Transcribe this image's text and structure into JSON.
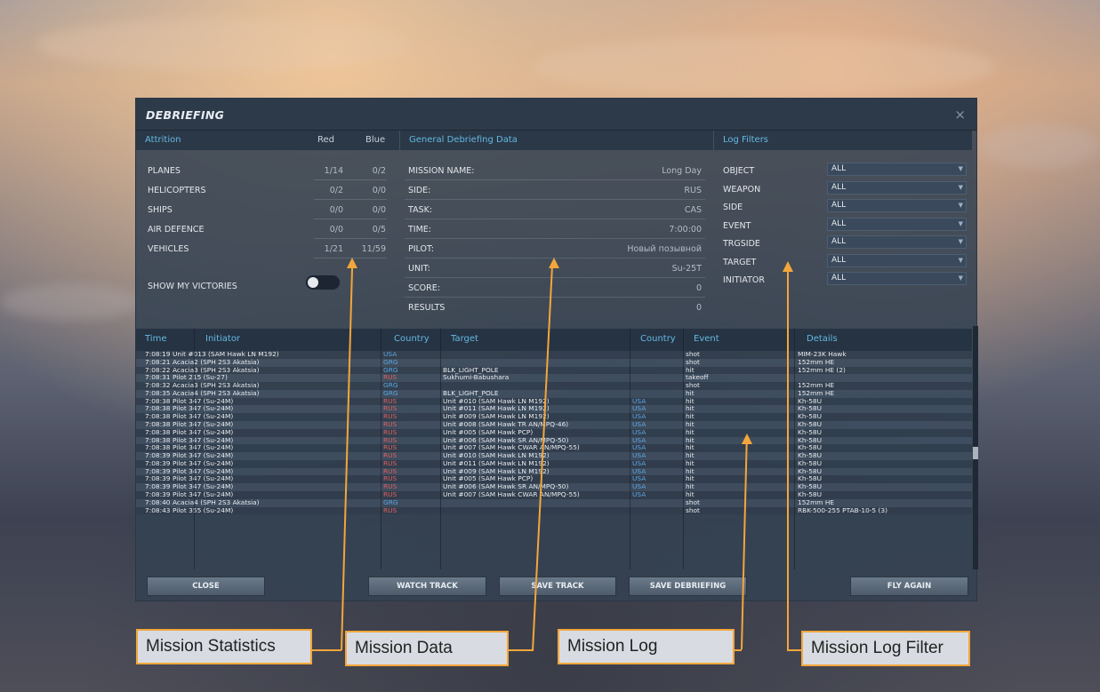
{
  "dialog": {
    "title": "DEBRIEFING",
    "close": "×"
  },
  "sections": {
    "attrition": "Attrition",
    "red": "Red",
    "blue": "Blue",
    "general": "General Debriefing Data",
    "filters": "Log Filters"
  },
  "attrition": [
    {
      "label": "PLANES",
      "red": "1/14",
      "blue": "0/2"
    },
    {
      "label": "HELICOPTERS",
      "red": "0/2",
      "blue": "0/0"
    },
    {
      "label": "SHIPS",
      "red": "0/0",
      "blue": "0/0"
    },
    {
      "label": "AIR DEFENCE",
      "red": "0/0",
      "blue": "0/5"
    },
    {
      "label": "VEHICLES",
      "red": "1/21",
      "blue": "11/59"
    }
  ],
  "show_victories": "SHOW MY VICTORIES",
  "general": [
    {
      "label": "MISSION NAME:",
      "value": "Long Day"
    },
    {
      "label": "SIDE:",
      "value": "RUS"
    },
    {
      "label": "TASK:",
      "value": "CAS"
    },
    {
      "label": "TIME:",
      "value": "7:00:00"
    },
    {
      "label": "PILOT:",
      "value": "Новый позывной"
    },
    {
      "label": "UNIT:",
      "value": "Su-25T"
    },
    {
      "label": "SCORE:",
      "value": "0"
    },
    {
      "label": "RESULTS",
      "value": "0"
    }
  ],
  "filters": [
    {
      "label": "OBJECT",
      "value": "ALL"
    },
    {
      "label": "WEAPON",
      "value": "ALL"
    },
    {
      "label": "SIDE",
      "value": "ALL"
    },
    {
      "label": "EVENT",
      "value": "ALL"
    },
    {
      "label": "TRGSIDE",
      "value": "ALL"
    },
    {
      "label": "TARGET",
      "value": "ALL"
    },
    {
      "label": "INITIATOR",
      "value": "ALL"
    }
  ],
  "log": {
    "headers": [
      "Time",
      "Initiator",
      "Country",
      "Target",
      "Country",
      "Event",
      "Details"
    ],
    "rows": [
      [
        "7:08:19",
        "Unit #013 (SAM Hawk LN M192)",
        "USA",
        "",
        "",
        "shot",
        "MIM-23K Hawk"
      ],
      [
        "7:08:21",
        "Acacia2 (SPH 2S3 Akatsia)",
        "GRG",
        "",
        "",
        "shot",
        "152mm HE"
      ],
      [
        "7:08:22",
        "Acacia3 (SPH 2S3 Akatsia)",
        "GRG",
        "BLK_LIGHT_POLE",
        "",
        "hit",
        "152mm HE (2)"
      ],
      [
        "7:08:31",
        "Pilot 215 (Su-27)",
        "RUS",
        "Sukhumi-Babushara",
        "",
        "takeoff",
        ""
      ],
      [
        "7:08:32",
        "Acacia3 (SPH 2S3 Akatsia)",
        "GRG",
        "",
        "",
        "shot",
        "152mm HE"
      ],
      [
        "7:08:35",
        "Acacia4 (SPH 2S3 Akatsia)",
        "GRG",
        "BLK_LIGHT_POLE",
        "",
        "hit",
        "152mm HE"
      ],
      [
        "7:08:38",
        "Pilot 347 (Su-24M)",
        "RUS",
        "Unit #010 (SAM Hawk LN M192)",
        "USA",
        "hit",
        "Kh-58U"
      ],
      [
        "7:08:38",
        "Pilot 347 (Su-24M)",
        "RUS",
        "Unit #011 (SAM Hawk LN M192)",
        "USA",
        "hit",
        "Kh-58U"
      ],
      [
        "7:08:38",
        "Pilot 347 (Su-24M)",
        "RUS",
        "Unit #009 (SAM Hawk LN M192)",
        "USA",
        "hit",
        "Kh-58U"
      ],
      [
        "7:08:38",
        "Pilot 347 (Su-24M)",
        "RUS",
        "Unit #008 (SAM Hawk TR AN/MPQ-46)",
        "USA",
        "hit",
        "Kh-58U"
      ],
      [
        "7:08:38",
        "Pilot 347 (Su-24M)",
        "RUS",
        "Unit #005 (SAM Hawk PCP)",
        "USA",
        "hit",
        "Kh-58U"
      ],
      [
        "7:08:38",
        "Pilot 347 (Su-24M)",
        "RUS",
        "Unit #006 (SAM Hawk SR AN/MPQ-50)",
        "USA",
        "hit",
        "Kh-58U"
      ],
      [
        "7:08:38",
        "Pilot 347 (Su-24M)",
        "RUS",
        "Unit #007 (SAM Hawk CWAR AN/MPQ-55)",
        "USA",
        "hit",
        "Kh-58U"
      ],
      [
        "7:08:39",
        "Pilot 347 (Su-24M)",
        "RUS",
        "Unit #010 (SAM Hawk LN M192)",
        "USA",
        "hit",
        "Kh-58U"
      ],
      [
        "7:08:39",
        "Pilot 347 (Su-24M)",
        "RUS",
        "Unit #011 (SAM Hawk LN M192)",
        "USA",
        "hit",
        "Kh-58U"
      ],
      [
        "7:08:39",
        "Pilot 347 (Su-24M)",
        "RUS",
        "Unit #009 (SAM Hawk LN M192)",
        "USA",
        "hit",
        "Kh-58U"
      ],
      [
        "7:08:39",
        "Pilot 347 (Su-24M)",
        "RUS",
        "Unit #005 (SAM Hawk PCP)",
        "USA",
        "hit",
        "Kh-58U"
      ],
      [
        "7:08:39",
        "Pilot 347 (Su-24M)",
        "RUS",
        "Unit #006 (SAM Hawk SR AN/MPQ-50)",
        "USA",
        "hit",
        "Kh-58U"
      ],
      [
        "7:08:39",
        "Pilot 347 (Su-24M)",
        "RUS",
        "Unit #007 (SAM Hawk CWAR AN/MPQ-55)",
        "USA",
        "hit",
        "Kh-58U"
      ],
      [
        "7:08:40",
        "Acacia4 (SPH 2S3 Akatsia)",
        "GRG",
        "",
        "",
        "shot",
        "152mm HE"
      ],
      [
        "7:08:43",
        "Pilot 355 (Su-24M)",
        "RUS",
        "",
        "",
        "shot",
        "RBK-500-255 PTAB-10-5 (3)"
      ]
    ]
  },
  "buttons": {
    "close": "CLOSE",
    "watch_track": "WATCH TRACK",
    "save_track": "SAVE TRACK",
    "save_debriefing": "SAVE DEBRIEFING",
    "fly_again": "FLY AGAIN"
  },
  "callouts": {
    "stats": "Mission Statistics",
    "data": "Mission Data",
    "log": "Mission Log",
    "filter": "Mission Log Filter"
  },
  "colors": {
    "accent": "#63b9e3",
    "red_side": "#e06060",
    "blue_side": "#5aa6e6",
    "callout": "#f3a63b"
  }
}
